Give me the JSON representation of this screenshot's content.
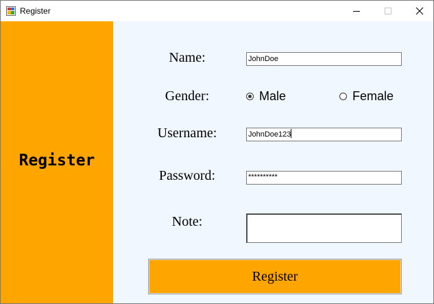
{
  "window": {
    "title": "Register",
    "icon": "winforms-app-icon",
    "controls": [
      "minimize-icon",
      "maximize-icon",
      "close-icon"
    ]
  },
  "sidebar": {
    "title": "Register",
    "background": "#ffa500"
  },
  "form": {
    "background": "#f0f7ff",
    "name_label": "Name:",
    "name_value": "JohnDoe",
    "gender_label": "Gender:",
    "gender_options": [
      {
        "label": "Male",
        "selected": true
      },
      {
        "label": "Female",
        "selected": false
      }
    ],
    "username_label": "Username:",
    "username_value": "JohnDoe123",
    "password_label": "Password:",
    "password_value": "**********",
    "note_label": "Note:",
    "note_value": "",
    "submit_label": "Register",
    "submit_color": "#ffa500"
  }
}
